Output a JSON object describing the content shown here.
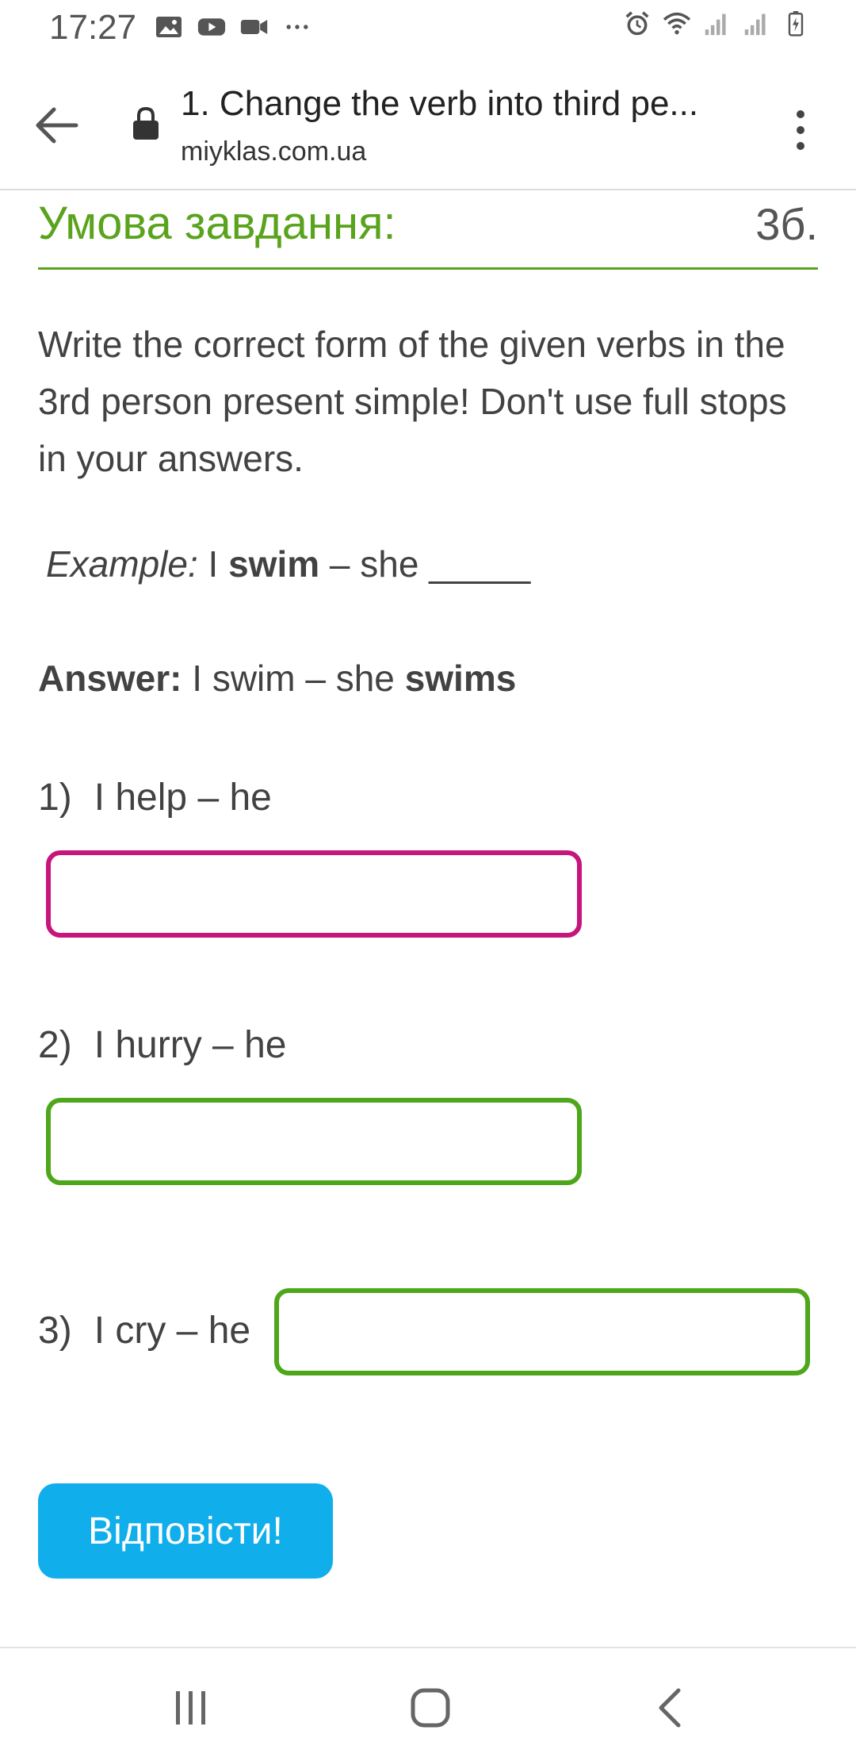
{
  "status_bar": {
    "time": "17:27",
    "left_icons": [
      "image-icon",
      "youtube-icon",
      "video-camera-icon",
      "more-dots-icon"
    ],
    "right_icons": [
      "alarm-icon",
      "wifi-icon",
      "signal-icon",
      "signal-icon",
      "battery-charging-icon"
    ]
  },
  "browser": {
    "page_title": "1. Change the verb into third pe...",
    "domain": "miyklas.com.ua"
  },
  "task": {
    "heading": "Умова завдання:",
    "points": "3б.",
    "instructions": "Write the correct form of the given verbs in the 3rd person present simple! Don't use full stops in your answers.",
    "example": {
      "label": "Example:",
      "part1": " I ",
      "bold1": "swim",
      "part2": " – she _____"
    },
    "answer": {
      "label": "Answer:",
      "part1": " I swim – she ",
      "bold1": "swims"
    },
    "questions": [
      {
        "number": "1)",
        "text": "I help – he",
        "value": "",
        "border_color": "#c7157b"
      },
      {
        "number": "2)",
        "text": "I hurry – he",
        "value": "",
        "border_color": "#4ea61b"
      },
      {
        "number": "3)",
        "text": "I cry – he",
        "value": "",
        "border_color": "#4ea61b"
      }
    ],
    "submit_label": "Відповісти!"
  },
  "colors": {
    "accent_green": "#5aa31d",
    "submit_blue": "#10aeea",
    "pink_border": "#c7157b"
  }
}
